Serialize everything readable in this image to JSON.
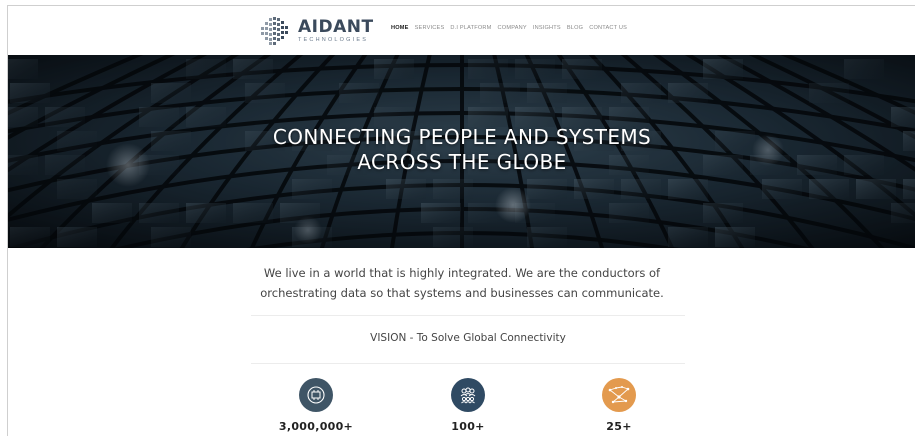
{
  "brand": {
    "name": "AIDANT",
    "tagline": "TECHNOLOGIES"
  },
  "nav": {
    "items": [
      {
        "label": "HOME",
        "active": true
      },
      {
        "label": "SERVICES",
        "active": false
      },
      {
        "label": "D.I PLATFORM",
        "active": false
      },
      {
        "label": "COMPANY",
        "active": false
      },
      {
        "label": "INSIGHTS",
        "active": false
      },
      {
        "label": "BLOG",
        "active": false
      },
      {
        "label": "CONTACT US",
        "active": false
      }
    ]
  },
  "hero": {
    "line1": "CONNECTING PEOPLE AND SYSTEMS",
    "line2": "ACROSS THE GLOBE"
  },
  "intro": {
    "line1": "We live in a world that is highly integrated. We are the conductors of",
    "line2": "orchestrating data so that systems and businesses can communicate."
  },
  "vision": "VISION - To Solve Global Connectivity",
  "stats": [
    {
      "value": "3,000,000+",
      "icon": "data-chip-icon",
      "color": "#3f5566"
    },
    {
      "value": "100+",
      "icon": "people-group-icon",
      "color": "#2f4a63"
    },
    {
      "value": "25+",
      "icon": "network-nodes-icon",
      "color": "#e39a4e"
    }
  ]
}
